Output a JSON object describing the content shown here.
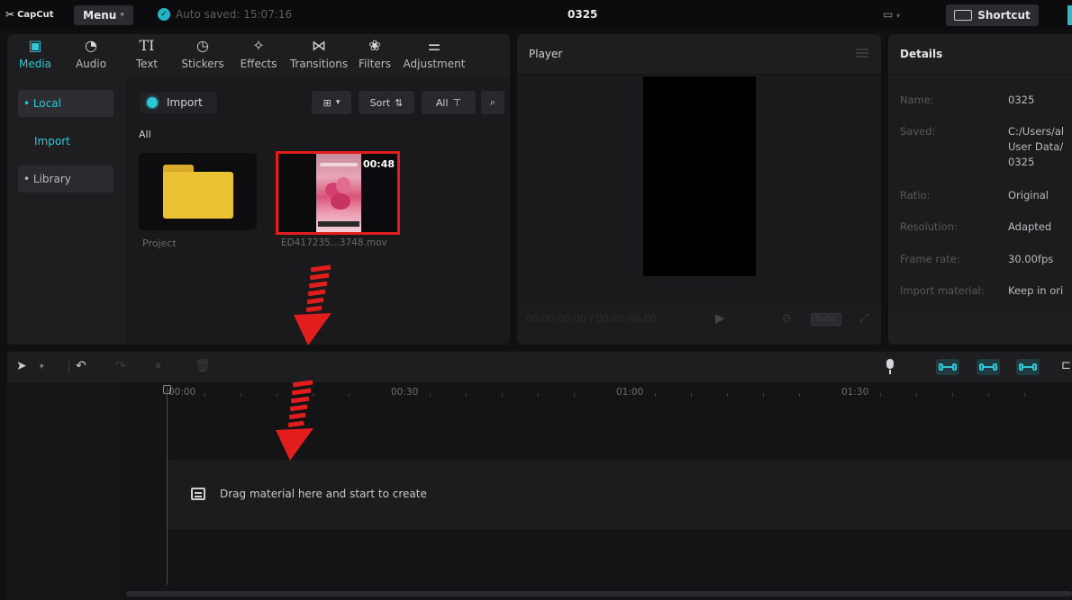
{
  "app": {
    "logo_text": "CapCut",
    "menu_label": "Menu",
    "autosave_text": "Auto saved: 15:07:16",
    "project_title": "0325",
    "shortcut_label": "Shortcut"
  },
  "media_tabs": [
    {
      "label": "Media",
      "icon": "media-icon",
      "glyph": "▣"
    },
    {
      "label": "Audio",
      "icon": "audio-icon",
      "glyph": "◔"
    },
    {
      "label": "Text",
      "icon": "text-icon",
      "glyph": "TI"
    },
    {
      "label": "Stickers",
      "icon": "sticker-icon",
      "glyph": "◷"
    },
    {
      "label": "Effects",
      "icon": "effects-icon",
      "glyph": "✧"
    },
    {
      "label": "Transitions",
      "icon": "transitions-icon",
      "glyph": "⋈"
    },
    {
      "label": "Filters",
      "icon": "filters-icon",
      "glyph": "❀"
    },
    {
      "label": "Adjustment",
      "icon": "adjustment-icon",
      "glyph": "⚌"
    }
  ],
  "sidebar": {
    "local": "• Local",
    "import": "Import",
    "library": "• Library"
  },
  "media": {
    "import_label": "Import",
    "sort_label": "Sort",
    "all_button": "All",
    "all_heading": "All",
    "items": [
      {
        "label": "Project",
        "kind": "folder"
      },
      {
        "label": "ED417235...3748.mov",
        "kind": "video",
        "duration": "00:48"
      }
    ]
  },
  "player": {
    "title": "Player",
    "timecode": "00:00:00:00 / 00:00:00:00",
    "ratio": "Ratio"
  },
  "details": {
    "title": "Details",
    "rows": [
      {
        "label": "Name:",
        "value": "0325"
      },
      {
        "label": "Saved:",
        "value": "C:/Users/al\nUser Data/\n0325"
      },
      {
        "label": "Ratio:",
        "value": "Original"
      },
      {
        "label": "Resolution:",
        "value": "Adapted"
      },
      {
        "label": "Frame rate:",
        "value": "30.00fps"
      },
      {
        "label": "Import material:",
        "value": "Keep in ori"
      }
    ]
  },
  "timeline": {
    "ruler": [
      "00:00",
      "00:30",
      "01:00",
      "01:30"
    ],
    "drop_hint": "Drag material here and start to create"
  },
  "colors": {
    "accent": "#2fc7d6",
    "highlight": "#e11d1d",
    "folder": "#e9c133"
  }
}
